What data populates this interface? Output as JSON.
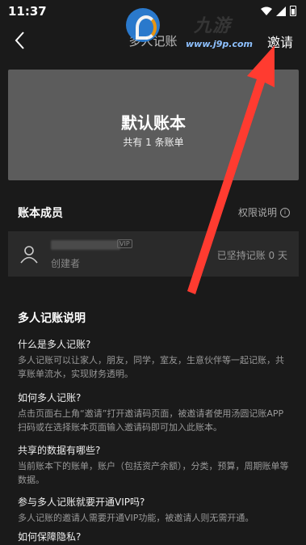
{
  "status": {
    "time": "11:37"
  },
  "nav": {
    "title": "多人记账",
    "invite_label": "邀请"
  },
  "watermark": {
    "site": "www.j9p.com",
    "brand": "九游"
  },
  "book": {
    "name": "默认账本",
    "count_text": "共有 1 条账单"
  },
  "members": {
    "title": "账本成员",
    "perm_label": "权限说明",
    "items": [
      {
        "vip": "VIP",
        "role": "创建者",
        "days": "已坚持记账 0 天"
      }
    ]
  },
  "explain": {
    "title": "多人记账说明",
    "items": [
      {
        "q": "什么是多人记账?",
        "a": "多人记账可以让家人，朋友，同学，室友，生意伙伴等一起记账，共享账单流水，实现财务透明。"
      },
      {
        "q": "如何多人记账?",
        "a": "点击页面右上角“邀请”打开邀请码页面，被邀请者使用汤圆记账APP扫码或在选择账本页面输入邀请码即可加入此账本。"
      },
      {
        "q": "共享的数据有哪些?",
        "a": "当前账本下的账单，账户（包括资产余额），分类，预算，周期账单等数据。"
      },
      {
        "q": "参与多人记账就要开通VIP吗?",
        "a": "多人记账的邀请人需要开通VIP功能，被邀请人则无需开通。"
      },
      {
        "q": "如何保障隐私?",
        "a": ""
      }
    ]
  },
  "colors": {
    "background": "#1a1a1a",
    "card": "#5c5c5c",
    "arrow": "#ff3b30"
  }
}
